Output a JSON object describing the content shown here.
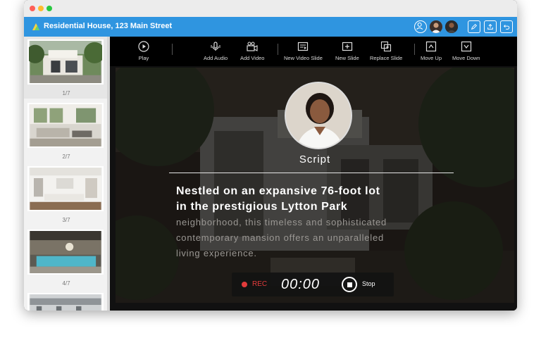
{
  "window": {
    "title": "Residential House, 123 Main Street"
  },
  "colors": {
    "accent": "#2f95e0",
    "rec": "#e23b3b"
  },
  "sidebar": {
    "slides": [
      {
        "label": "1/7",
        "scene": "house-exterior"
      },
      {
        "label": "2/7",
        "scene": "living-room"
      },
      {
        "label": "3/7",
        "scene": "kitchen"
      },
      {
        "label": "4/7",
        "scene": "pool-patio"
      },
      {
        "label": "",
        "scene": "terrace"
      }
    ],
    "selected_index": 0
  },
  "toolbar": {
    "play": "Play",
    "add_audio": "Add Audio",
    "add_video": "Add Video",
    "new_video_slide": "New Video Slide",
    "new_slide": "New Slide",
    "replace_slide": "Replace Slide",
    "move_up": "Move Up",
    "move_down": "Move Down"
  },
  "stage": {
    "script_title": "Script",
    "script_highlight": [
      "Nestled on an expansive 76-foot lot",
      "in the prestigious Lytton Park"
    ],
    "script_rest": [
      "neighborhood, this timeless and sophisticated",
      "contemporary mansion offers an unparalleled",
      "living experience."
    ]
  },
  "recorder": {
    "rec_label": "REC",
    "timer": "00:00",
    "stop_label": "Stop"
  }
}
